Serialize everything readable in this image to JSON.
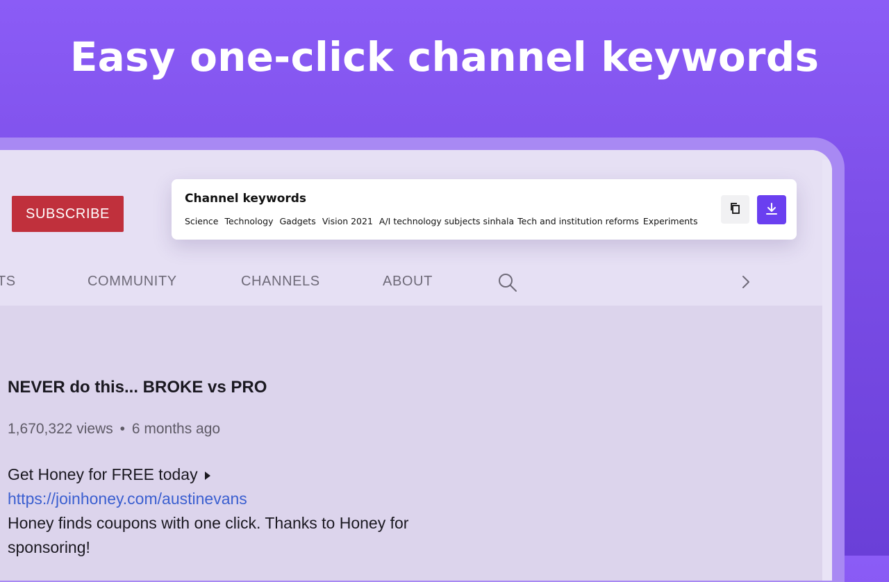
{
  "headline": "Easy one-click channel keywords",
  "channel_page": {
    "subscribe_label": "SUBSCRIBE",
    "tabs": [
      {
        "label": "STS"
      },
      {
        "label": "COMMUNITY"
      },
      {
        "label": "CHANNELS"
      },
      {
        "label": "ABOUT"
      }
    ],
    "icons": {
      "search": "search-icon",
      "next": "chevron-right-icon"
    },
    "video": {
      "title": "NEVER do this... BROKE vs PRO",
      "views": "1,670,322 views",
      "separator": "•",
      "age": "6 months ago",
      "desc_line1": "Get Honey for FREE today",
      "link": "https://joinhoney.com/austinevans",
      "desc_line3": "Honey finds coupons with one click. Thanks to Honey for sponsoring!"
    }
  },
  "keywords_panel": {
    "title": "Channel keywords",
    "keywords": [
      "Science",
      "Technology",
      "Gadgets",
      "Vision 2021",
      "A/I technology subjects sinhala",
      "Tech and institution reforms",
      "Experiments"
    ],
    "copy_icon": "copy-icon",
    "download_icon": "download-icon",
    "accent_color": "#6a3ff0"
  },
  "colors": {
    "background": "#8b5cf6",
    "subscribe": "#c0303c",
    "link": "#3b5fd0"
  }
}
